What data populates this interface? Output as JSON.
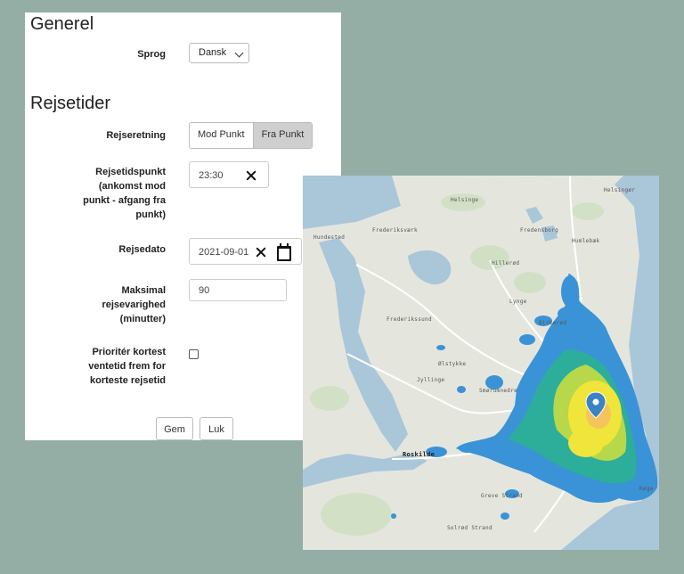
{
  "general": {
    "title": "Generel",
    "language_label": "Sprog",
    "language_value": "Dansk"
  },
  "travel": {
    "title": "Rejsetider",
    "direction_label": "Rejseretning",
    "direction_options": [
      "Mod Punkt",
      "Fra Punkt"
    ],
    "direction_selected": "Fra Punkt",
    "time_label_lines": [
      "Rejsetidspunkt",
      "(ankomst mod",
      "punkt - afgang fra",
      "punkt)"
    ],
    "time_value": "23:30",
    "date_label": "Rejsedato",
    "date_value": "2021-09-01",
    "max_label_lines": [
      "Maksimal",
      "rejsevarighed",
      "(minutter)"
    ],
    "max_value": "90",
    "prioritize_label_lines": [
      "Prioritér kortest",
      "ventetid frem for",
      "korteste rejsetid"
    ],
    "prioritize_checked": false
  },
  "buttons": {
    "save": "Gem",
    "close": "Luk"
  },
  "map": {
    "places": [
      "Helsingør",
      "Helsinge",
      "Hundested",
      "Frederiksværk",
      "Fredensborg",
      "Humlebæk",
      "Hillerød",
      "Frederikssund",
      "Lynge",
      "Birkerød",
      "Ølstykke",
      "Jyllinge",
      "Smørumnedre",
      "Roskilde",
      "Greve Strand",
      "Solrød Strand",
      "Køge"
    ],
    "marker": "map-pin",
    "colors": {
      "water": "#aac6d9",
      "land": "#e4e6de",
      "isochrone_outer": "#3a93d6",
      "isochrone_mid": "#2cae9a",
      "isochrone_inner": "#d6e64a",
      "isochrone_core": "#f5e437",
      "marker": "#3c83c4"
    }
  }
}
